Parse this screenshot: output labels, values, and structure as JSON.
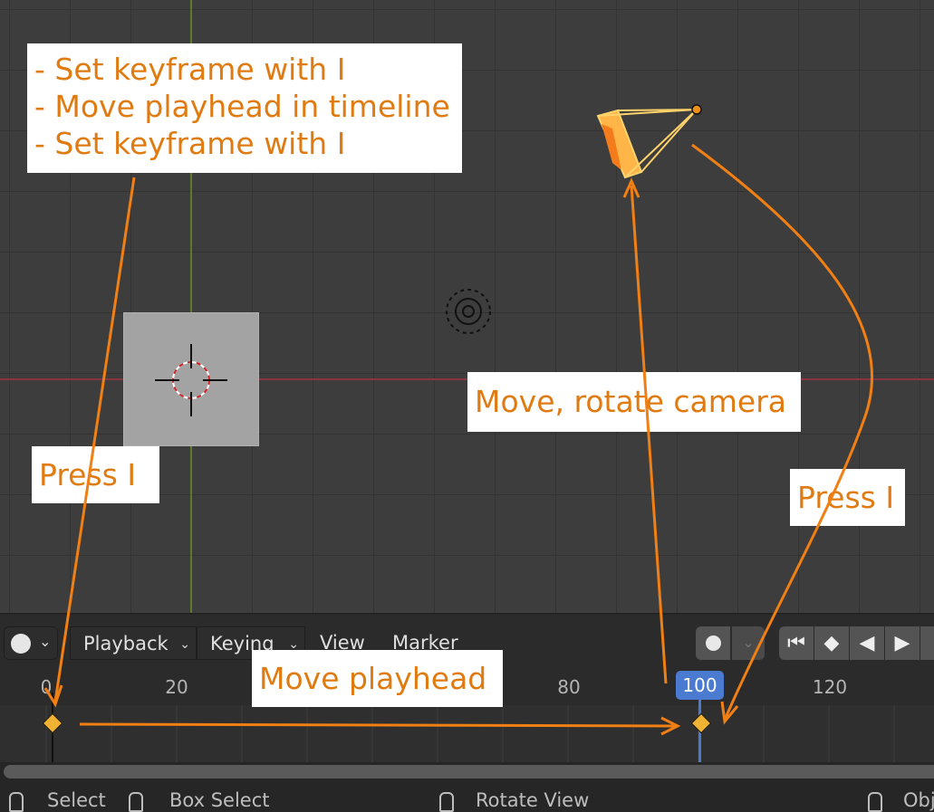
{
  "annotations": {
    "steps": [
      "- Set keyframe with I",
      "- Move playhead in timeline",
      "- Set keyframe with I"
    ],
    "press_left": "Press I",
    "move_camera": "Move, rotate camera",
    "press_right": "Press I",
    "move_playhead": "Move playhead"
  },
  "timeline_header": {
    "editor_type_icon": "clock-icon",
    "menus": {
      "playback": "Playback",
      "keying": "Keying",
      "view": "View",
      "marker": "Marker"
    },
    "record_icon": "record-dot-icon",
    "playback_buttons": [
      "jump-to-start-icon",
      "jump-to-keyframe-icon",
      "play-reverse-icon",
      "play-icon"
    ]
  },
  "ruler": {
    "ticks": [
      "0",
      "20",
      "80",
      "120"
    ]
  },
  "playhead": {
    "frame": "100"
  },
  "keyframes": [
    0,
    100
  ],
  "status_bar": {
    "select": "Select",
    "box_select": "Box Select",
    "rotate_view": "Rotate View",
    "object": "Obj"
  },
  "colors": {
    "accent": "#e07b12",
    "playhead": "#4a7bd1",
    "keyframe": "#f0b233"
  }
}
